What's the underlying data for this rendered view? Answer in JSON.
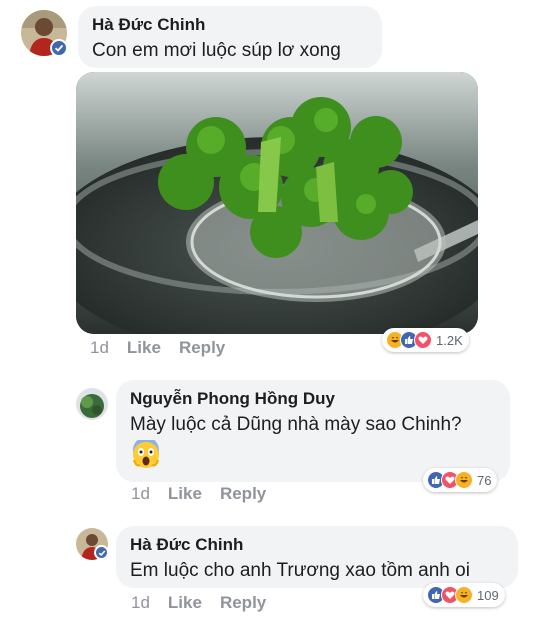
{
  "comment1": {
    "author": "Hà Đức Chinh",
    "text": "Con em mơi luộc súp lơ xong",
    "time": "1d",
    "like_label": "Like",
    "reply_label": "Reply",
    "reactions_count": "1.2K",
    "reaction_icons": [
      "haha-icon",
      "like-icon",
      "love-icon"
    ]
  },
  "reply1": {
    "author": "Nguyễn Phong Hồng Duy",
    "text": "Mày luộc cả Dũng nhà mày sao Chinh?",
    "time": "1d",
    "like_label": "Like",
    "reply_label": "Reply",
    "reactions_count": "76",
    "reaction_icons": [
      "like-icon",
      "love-icon",
      "haha-icon"
    ]
  },
  "reply2": {
    "author": "Hà Đức Chinh",
    "text": "Em luộc cho anh Trương xao tồm anh oi",
    "time": "1d",
    "like_label": "Like",
    "reply_label": "Reply",
    "reactions_count": "109",
    "reaction_icons": [
      "like-icon",
      "love-icon",
      "haha-icon"
    ]
  },
  "colors": {
    "facebook_blue": "#4267b2",
    "love_red": "#f25268",
    "haha_yellow": "#f7b125",
    "bubble_gray": "#f2f3f5",
    "meta_gray": "#90949c"
  }
}
